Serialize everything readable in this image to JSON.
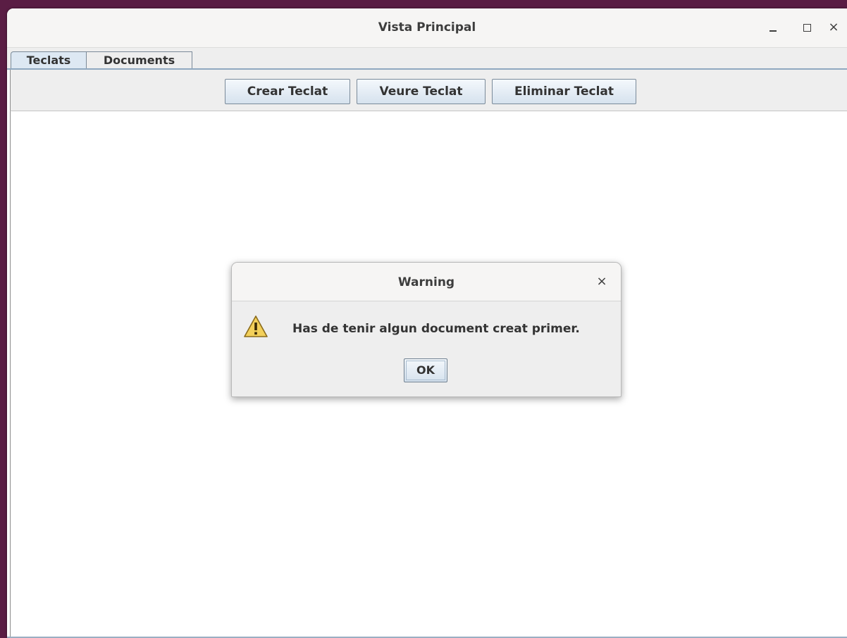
{
  "window": {
    "title": "Vista Principal",
    "controls": {
      "minimize": "minimize-icon",
      "maximize": "maximize-icon",
      "close": "×"
    }
  },
  "tabs": [
    {
      "label": "Teclats",
      "active": true
    },
    {
      "label": "Documents",
      "active": false
    }
  ],
  "toolbar": {
    "crear_label": "Crear Teclat",
    "veure_label": "Veure Teclat",
    "eliminar_label": "Eliminar Teclat"
  },
  "dialog": {
    "title": "Warning",
    "close": "×",
    "icon": "warning-icon",
    "message": "Has de tenir algun document creat primer.",
    "ok_label": "OK"
  },
  "colors": {
    "desktop": "#5a1d44",
    "button_top": "#f4f8fc",
    "button_bottom": "#d6e2ee",
    "tab_active": "#dde8f3",
    "warning_fill": "#f3d05a"
  }
}
